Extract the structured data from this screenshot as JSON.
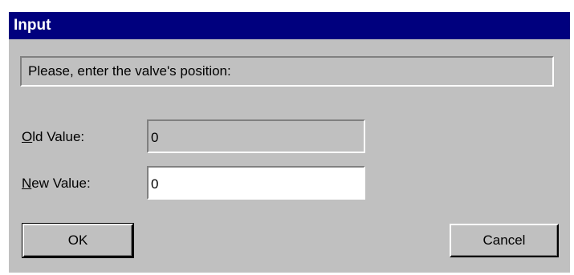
{
  "window": {
    "title": "Input"
  },
  "prompt": {
    "text": "Please, enter the valve's position:"
  },
  "fields": {
    "old_value": {
      "mnemonic": "O",
      "label_rest": "ld Value:",
      "value": "0"
    },
    "new_value": {
      "mnemonic": "N",
      "label_rest": "ew Value:",
      "value": "0"
    }
  },
  "buttons": {
    "ok_label": "OK",
    "cancel_label": "Cancel"
  },
  "colors": {
    "title_bar": "#00007e",
    "dialog_face": "#c0c0c0"
  }
}
